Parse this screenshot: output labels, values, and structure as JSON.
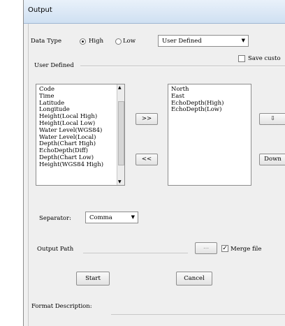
{
  "window": {
    "title": "Output"
  },
  "data_type": {
    "label": "Data Type",
    "options": [
      "High",
      "Low"
    ],
    "selected": "High",
    "mode_value": "User Defined"
  },
  "save_custom": {
    "label": "Save custo",
    "checked": false
  },
  "user_defined": {
    "label": "User Defined"
  },
  "available_fields": [
    "Code",
    "Time",
    "Latitude",
    "Longitude",
    "Height(Local High)",
    "Height(Local Low)",
    "Water Level(WGS84)",
    "Water Level(Local)",
    "Depth(Chart High)",
    "EchoDepth(Diff)",
    "Depth(Chart Low)",
    "Height(WGS84 High)"
  ],
  "selected_fields": [
    "North",
    "East",
    "EchoDepth(High)",
    "EchoDepth(Low)"
  ],
  "buttons": {
    "add": ">>",
    "remove": "<<",
    "up_arrow": "⇩",
    "down": "Down",
    "browse": "...",
    "start": "Start",
    "cancel": "Cancel"
  },
  "separator": {
    "label": "Separator:",
    "value": "Comma"
  },
  "output_path": {
    "label": "Output Path",
    "value": ""
  },
  "merge_file": {
    "label": "Merge file",
    "checked": true
  },
  "format_description": {
    "label": "Format Description:"
  }
}
